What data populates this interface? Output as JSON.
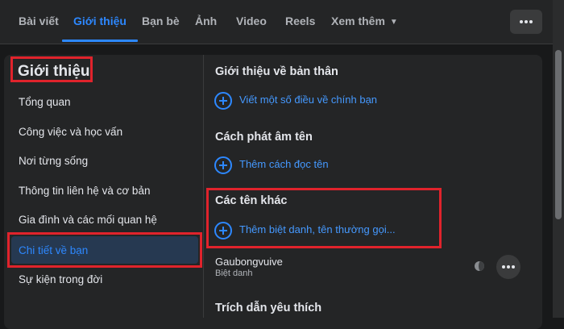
{
  "nav": {
    "tabs": [
      "Bài viết",
      "Giới thiệu",
      "Bạn bè",
      "Ảnh",
      "Video",
      "Reels"
    ],
    "more_label": "Xem thêm",
    "active_tab": "Giới thiệu"
  },
  "sidebar": {
    "title": "Giới thiệu",
    "items": [
      "Tổng quan",
      "Công việc và học vấn",
      "Nơi từng sống",
      "Thông tin liên hệ và cơ bản",
      "Gia đình và các mối quan hệ",
      "Chi tiết về bạn",
      "Sự kiện trong đời"
    ],
    "active_item": "Chi tiết về bạn"
  },
  "main": {
    "about_title": "Giới thiệu về bản thân",
    "about_add": "Viết một số điều về chính bạn",
    "pronounce_title": "Cách phát âm tên",
    "pronounce_add": "Thêm cách đọc tên",
    "other_names_title": "Các tên khác",
    "other_names_add": "Thêm biệt danh, tên thường gọi...",
    "nickname_value": "Gaubongvuive",
    "nickname_type": "Biệt danh",
    "quotes_title": "Trích dẫn yêu thích"
  },
  "icons": {
    "more": "more-dots-icon",
    "add": "add-circle-icon",
    "privacy": "globe-icon",
    "options": "more-dots-icon"
  },
  "colors": {
    "accent": "#2d88ff",
    "highlight_border": "#e0232c",
    "background": "#18191a",
    "card": "#242526"
  }
}
